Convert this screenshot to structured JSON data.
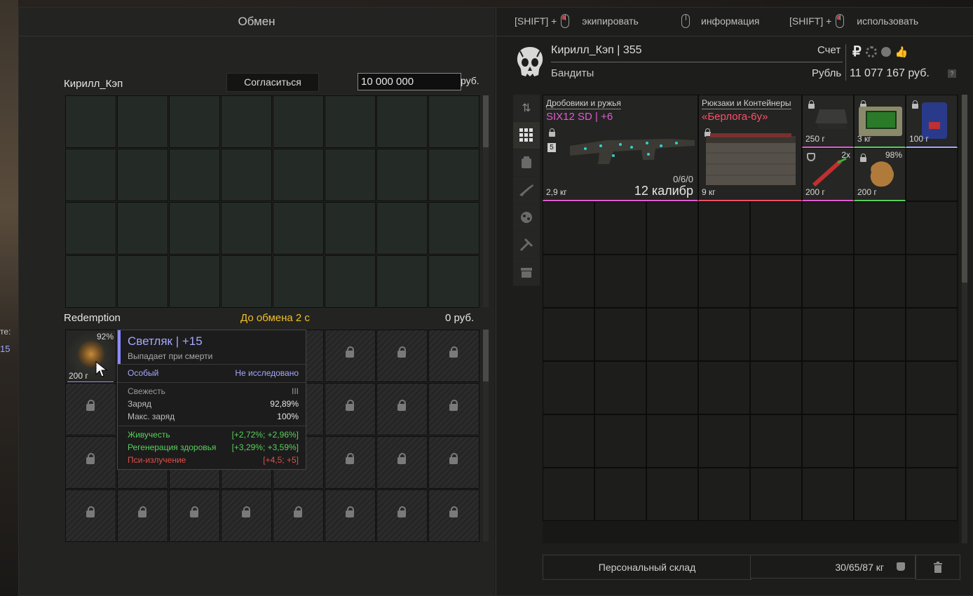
{
  "background": {
    "label_te": "те:",
    "label_num": "15"
  },
  "left_panel": {
    "title": "Обмен",
    "trader_name": "Кирилл_Кэп",
    "agree_button": "Согласиться",
    "money_value": "10 000 000",
    "money_unit": "руб.",
    "bottom_name": "Redemption",
    "timer": "До обмена 2 с",
    "bottom_money": "0 руб."
  },
  "slot_item": {
    "charge": "92%",
    "weight": "200 г"
  },
  "tooltip": {
    "title": "Светляк | +15",
    "subtitle": "Выпадает при смерти",
    "rarity": "Особый",
    "research": "Не исследовано",
    "stats": [
      {
        "label": "Свежесть",
        "value": "III"
      },
      {
        "label": "Заряд",
        "value": "92,89%"
      },
      {
        "label": "Макс. заряд",
        "value": "100%"
      }
    ],
    "effects": [
      {
        "label": "Живучесть",
        "value": "[+2,72%; +2,96%]",
        "color": "#57d15a"
      },
      {
        "label": "Регенерация здоровья",
        "value": "[+3,29%; +3,59%]",
        "color": "#57d15a"
      },
      {
        "label": "Пси-излучение",
        "value": "[+4,5; +5]",
        "color": "#e0504a"
      }
    ]
  },
  "hints": {
    "equip_prefix": "[SHIFT] +",
    "equip": "экипировать",
    "info": "информация",
    "use_prefix": "[SHIFT] +",
    "use": "использовать"
  },
  "player": {
    "name_level": "Кирилл_Кэп | 355",
    "faction": "Бандиты",
    "account_label": "Счет",
    "currency_label": "Рубль",
    "balance": "11 077 167 руб.",
    "currency_symbol": "₽",
    "help": "?"
  },
  "sidebar": [
    "sort-icon",
    "grid-icon",
    "backpack-icon",
    "rifle-icon",
    "artifact-icon",
    "tools-icon",
    "box-icon"
  ],
  "items": {
    "gun": {
      "category": "Дробовики и ружья",
      "name": "SIX12 SD | +6",
      "weight": "2,9 кг",
      "ammo": "0/6/0",
      "caliber": "12 калибр",
      "badge": "5",
      "color": "#e05bd0"
    },
    "container": {
      "category": "Рюкзаки и Контейнеры",
      "name": "«Берлога-6у»",
      "weight": "9 кг",
      "color": "#ff4f6a"
    },
    "sight": {
      "weight": "250 г"
    },
    "device": {
      "weight": "3 кг"
    },
    "battery": {
      "weight": "100 г"
    },
    "syringe": {
      "weight": "200 г",
      "count": "2x"
    },
    "artifact": {
      "weight": "200 г",
      "charge": "98%"
    }
  },
  "footer": {
    "storage": "Персональный склад",
    "weight": "30/65/87 кг"
  }
}
